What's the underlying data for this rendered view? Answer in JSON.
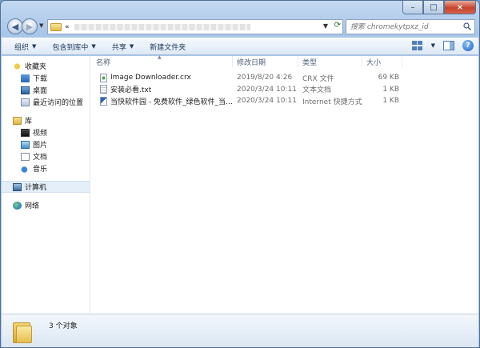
{
  "window": {
    "minimize_glyph": "–",
    "maximize_glyph": "□",
    "close_glyph": "×"
  },
  "address": {
    "prefix": "«",
    "search_placeholder": "搜索 chromekytpxz_id"
  },
  "toolbar": {
    "organize": "组织",
    "include_in_library": "包含到库中",
    "share": "共享",
    "new_folder": "新建文件夹",
    "help_glyph": "?"
  },
  "navpane": {
    "favorites": "收藏夹",
    "favorites_items": [
      "下载",
      "桌面",
      "最近访问的位置"
    ],
    "libraries": "库",
    "libraries_items": [
      "视频",
      "图片",
      "文档",
      "音乐"
    ],
    "computer": "计算机",
    "network": "网络"
  },
  "columns": {
    "name": "名称",
    "date": "修改日期",
    "type": "类型",
    "size": "大小"
  },
  "files": [
    {
      "name": "Image Downloader.crx",
      "date": "2019/8/20 4:26",
      "type": "CRX 文件",
      "size": "69 KB",
      "icon": "crx-file-icon"
    },
    {
      "name": "安装必看.txt",
      "date": "2020/3/24 10:11",
      "type": "文本文档",
      "size": "1 KB",
      "icon": "text-file-icon"
    },
    {
      "name": "当快软件园 - 免费软件_绿色软件_当快软...",
      "date": "2020/3/24 10:11",
      "type": "Internet 快捷方式",
      "size": "1 KB",
      "icon": "internet-shortcut-icon"
    }
  ],
  "status": {
    "count": "3 个对象"
  }
}
